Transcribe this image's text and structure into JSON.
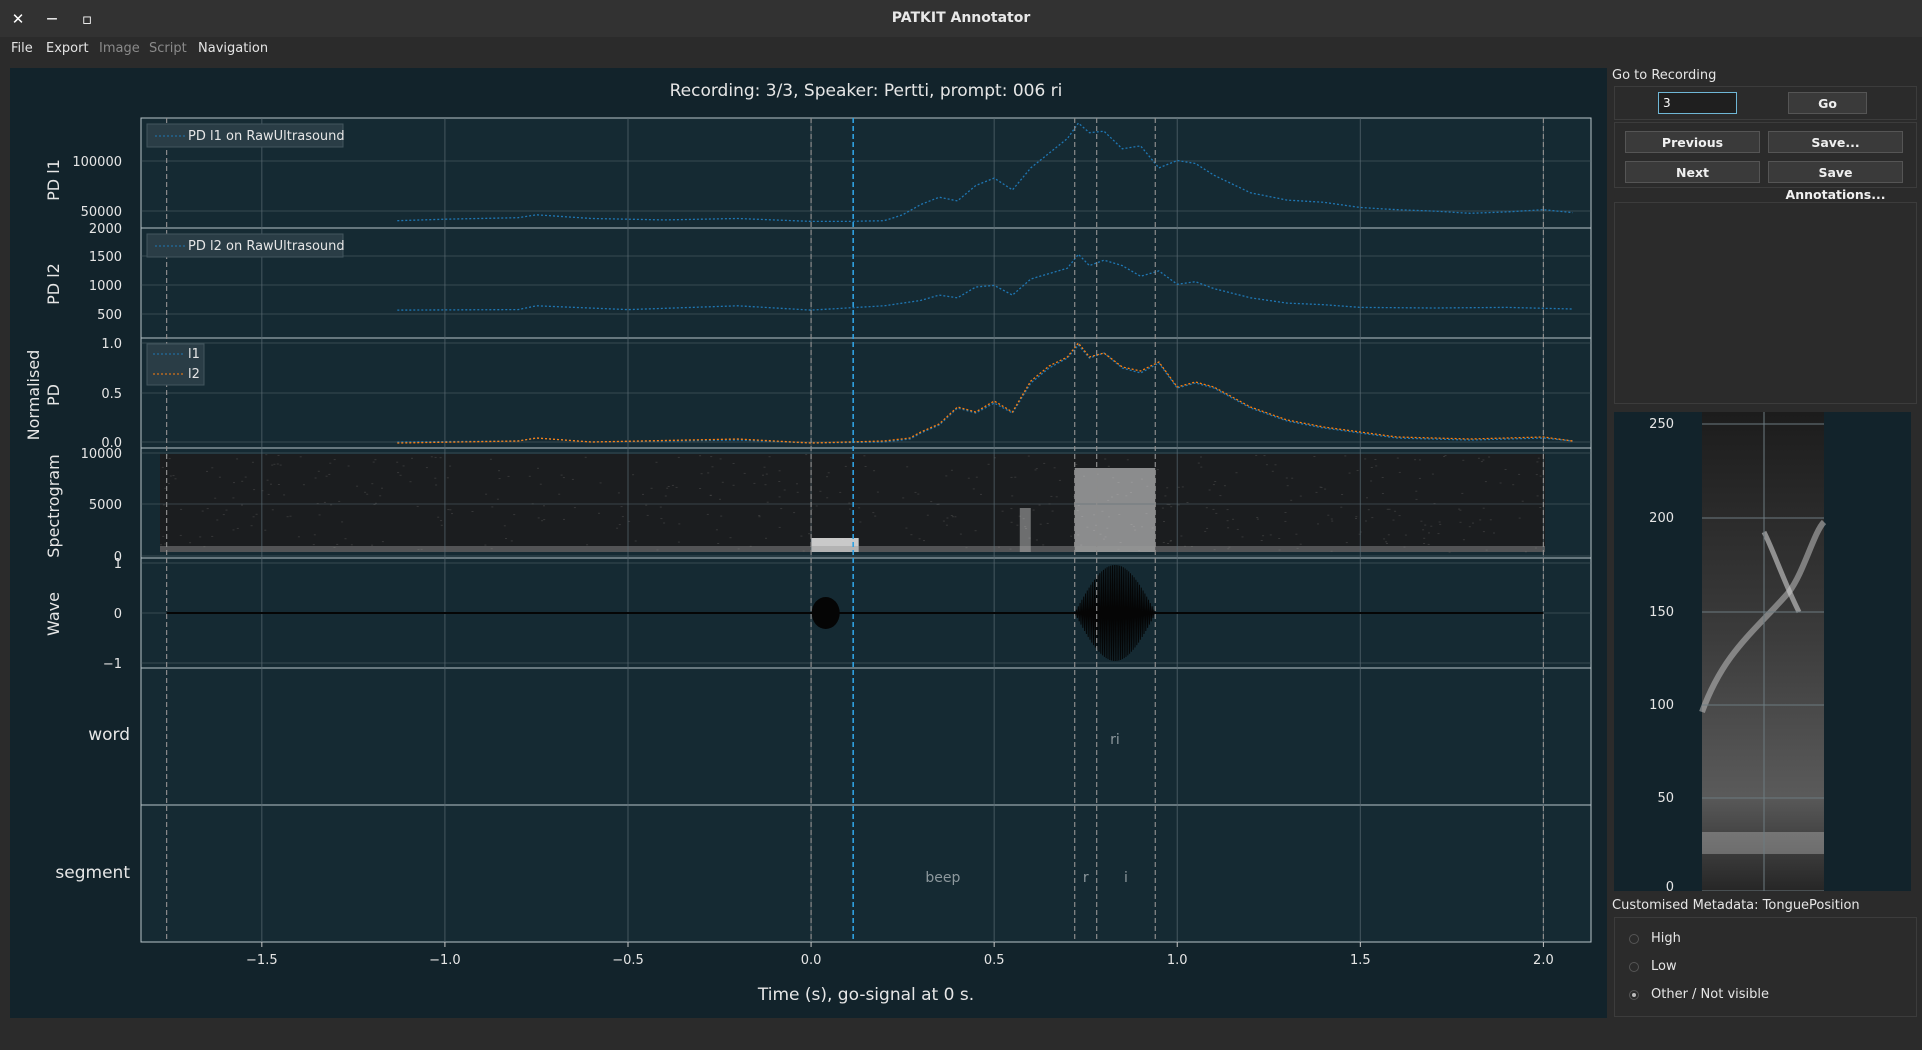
{
  "window": {
    "title": "PATKIT Annotator",
    "close_glyph": "✕",
    "minimize_glyph": "—",
    "maximize_glyph": "▫"
  },
  "menu": {
    "items": [
      {
        "label": "File",
        "enabled": true
      },
      {
        "label": "Export",
        "enabled": true
      },
      {
        "label": "Image",
        "enabled": false
      },
      {
        "label": "Script",
        "enabled": false
      },
      {
        "label": "Navigation",
        "enabled": true
      }
    ]
  },
  "figure": {
    "title": "Recording: 3/3, Speaker: Pertti, prompt: 006   ri",
    "xlabel": "Time (s), go-signal at 0 s.",
    "background": "#12232b",
    "panels": {
      "pd_l1": {
        "ylabel": "PD l1",
        "legend": "PD l1 on RawUltrasound",
        "yticks": [
          "100000",
          "50000"
        ]
      },
      "pd_l2": {
        "ylabel": "PD l2",
        "legend": "PD l2 on RawUltrasound",
        "yticks": [
          "2000",
          "1500",
          "1000",
          "500"
        ]
      },
      "norm_pd": {
        "ylabel_line1": "Normalised",
        "ylabel_line2": "PD",
        "legend": [
          "l1",
          "l2"
        ],
        "yticks": [
          "1.0",
          "0.5",
          "0.0"
        ]
      },
      "spectrogram": {
        "ylabel": "Spectrogram",
        "yticks": [
          "10000",
          "5000",
          "0"
        ]
      },
      "wave": {
        "ylabel": "Wave",
        "yticks": [
          "1",
          "0",
          "−1"
        ]
      },
      "word": {
        "ylabel": "word",
        "labels": [
          {
            "text": "ri",
            "t": 0.83
          }
        ]
      },
      "segment": {
        "ylabel": "segment",
        "labels": [
          {
            "text": "beep",
            "t": 0.36
          },
          {
            "text": "r",
            "t": 0.75
          },
          {
            "text": "i",
            "t": 0.86
          }
        ]
      }
    },
    "xticks": [
      "−1.5",
      "−1.0",
      "−0.5",
      "0.0",
      "0.5",
      "1.0",
      "1.5",
      "2.0"
    ],
    "colors": {
      "l1": "#1f77b4",
      "l2": "#ff7f0e",
      "cursor": "#2fa0e0",
      "boundary": "#8c8c8c",
      "grid": "#5a6a72"
    }
  },
  "chart_data": {
    "type": "line",
    "x_range": [
      -1.83,
      2.13
    ],
    "cursor_time": 0.115,
    "boundaries": [
      -1.76,
      0.0,
      0.72,
      0.78,
      0.94,
      2.0
    ],
    "series": [
      {
        "name": "PD l1 on RawUltrasound",
        "x": [
          -1.13,
          -1.0,
          -0.8,
          -0.75,
          -0.6,
          -0.4,
          -0.2,
          0.0,
          0.1,
          0.2,
          0.25,
          0.3,
          0.35,
          0.4,
          0.45,
          0.5,
          0.55,
          0.6,
          0.65,
          0.7,
          0.73,
          0.76,
          0.8,
          0.85,
          0.9,
          0.95,
          1.0,
          1.05,
          1.1,
          1.2,
          1.3,
          1.4,
          1.5,
          1.6,
          1.7,
          1.8,
          1.9,
          2.0,
          2.08
        ],
        "y": [
          30000,
          32000,
          34000,
          38000,
          33000,
          31000,
          33000,
          29000,
          29000,
          30000,
          38000,
          52000,
          62000,
          57000,
          78000,
          88000,
          72000,
          102000,
          122000,
          142000,
          163000,
          150000,
          152000,
          128000,
          132000,
          102000,
          112000,
          108000,
          92000,
          68000,
          58000,
          55000,
          48000,
          45000,
          43000,
          40000,
          42000,
          45000,
          41000
        ]
      },
      {
        "name": "PD l2 on RawUltrasound",
        "x": [
          -1.13,
          -0.8,
          -0.75,
          -0.5,
          -0.2,
          0.0,
          0.2,
          0.3,
          0.35,
          0.4,
          0.45,
          0.5,
          0.55,
          0.6,
          0.65,
          0.7,
          0.73,
          0.76,
          0.8,
          0.85,
          0.9,
          0.95,
          1.0,
          1.05,
          1.1,
          1.2,
          1.3,
          1.4,
          1.5,
          1.7,
          1.9,
          2.08
        ],
        "y": [
          520,
          530,
          600,
          530,
          600,
          520,
          600,
          700,
          800,
          750,
          950,
          980,
          800,
          1100,
          1200,
          1300,
          1560,
          1350,
          1450,
          1350,
          1150,
          1250,
          1000,
          1050,
          920,
          750,
          650,
          620,
          570,
          560,
          570,
          540
        ]
      },
      {
        "name": "l1",
        "x": [
          -1.13,
          -0.8,
          -0.75,
          -0.6,
          -0.2,
          0.0,
          0.2,
          0.27,
          0.3,
          0.35,
          0.4,
          0.45,
          0.5,
          0.55,
          0.6,
          0.65,
          0.7,
          0.73,
          0.76,
          0.8,
          0.85,
          0.9,
          0.95,
          1.0,
          1.05,
          1.1,
          1.2,
          1.3,
          1.4,
          1.5,
          1.6,
          1.8,
          2.0,
          2.08
        ],
        "y": [
          0.01,
          0.02,
          0.05,
          0.01,
          0.03,
          0.0,
          0.01,
          0.04,
          0.1,
          0.18,
          0.35,
          0.3,
          0.4,
          0.3,
          0.6,
          0.75,
          0.85,
          0.98,
          0.85,
          0.9,
          0.75,
          0.7,
          0.8,
          0.55,
          0.6,
          0.55,
          0.35,
          0.22,
          0.15,
          0.1,
          0.05,
          0.03,
          0.05,
          0.02
        ]
      },
      {
        "name": "l2",
        "x": [
          -1.13,
          -0.8,
          -0.75,
          -0.6,
          -0.2,
          0.0,
          0.2,
          0.27,
          0.3,
          0.35,
          0.4,
          0.45,
          0.5,
          0.55,
          0.6,
          0.65,
          0.7,
          0.73,
          0.76,
          0.8,
          0.85,
          0.9,
          0.95,
          1.0,
          1.05,
          1.1,
          1.2,
          1.3,
          1.4,
          1.5,
          1.6,
          1.8,
          2.0,
          2.08
        ],
        "y": [
          0.0,
          0.02,
          0.05,
          0.01,
          0.04,
          0.0,
          0.02,
          0.05,
          0.11,
          0.19,
          0.36,
          0.31,
          0.42,
          0.31,
          0.62,
          0.77,
          0.86,
          1.0,
          0.86,
          0.9,
          0.76,
          0.72,
          0.81,
          0.56,
          0.61,
          0.56,
          0.36,
          0.23,
          0.16,
          0.11,
          0.06,
          0.04,
          0.06,
          0.02
        ]
      }
    ],
    "ultrasound_yticks": [
      "250",
      "200",
      "150",
      "100",
      "50",
      "0"
    ]
  },
  "sidebar": {
    "goto": {
      "heading": "Go to Recording",
      "value": "3",
      "go_label": "Go"
    },
    "nav": {
      "previous_label": "Previous",
      "next_label": "Next",
      "save_label": "Save...",
      "save_annotations_label": "Save Annotations..."
    },
    "metadata": {
      "heading": "Customised Metadata: TonguePosition",
      "options": [
        {
          "label": "High",
          "checked": false
        },
        {
          "label": "Low",
          "checked": false
        },
        {
          "label": "Other / Not visible",
          "checked": true
        }
      ]
    }
  }
}
